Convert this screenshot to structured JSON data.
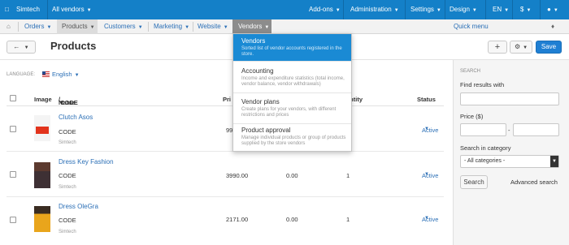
{
  "topbar": {
    "brand": "Simtech",
    "vendor_filter": "All vendors",
    "items": [
      "Add-ons",
      "Administration",
      "Settings",
      "Design"
    ],
    "lang": "EN",
    "currency": "$"
  },
  "menu": {
    "items": [
      "Orders",
      "Products",
      "Customers",
      "Marketing",
      "Website",
      "Vendors"
    ],
    "quick_menu": "Quick menu"
  },
  "header": {
    "title": "Products",
    "save_label": "Save"
  },
  "language": {
    "label": "LANGUAGE:",
    "value": "English"
  },
  "table": {
    "columns": {
      "image": "Image",
      "name": "Name",
      "code": "CODE",
      "price": "Pri",
      "quantity": "antity",
      "status": "Status"
    },
    "rows": [
      {
        "name": "Clutch Asos",
        "code": "CODE",
        "vendor": "Simtech",
        "price": "99",
        "list_price": "",
        "quantity": "",
        "status": "Active"
      },
      {
        "name": "Dress Key Fashion",
        "code": "CODE",
        "vendor": "Simtech",
        "price": "3990.00",
        "list_price": "0.00",
        "quantity": "1",
        "status": "Active"
      },
      {
        "name": "Dress OleGra",
        "code": "CODE",
        "vendor": "Simtech",
        "price": "2171.00",
        "list_price": "0.00",
        "quantity": "1",
        "status": "Active"
      }
    ]
  },
  "vendors_menu": [
    {
      "title": "Vendors",
      "desc": "Sorted list of vendor accounts registered in the store."
    },
    {
      "title": "Accounting",
      "desc": "Income and expenditure statistics (total income, vendor balance, vendor withdrawals)"
    },
    {
      "title": "Vendor plans",
      "desc": "Create plans for your vendors, with different restrictions and prices"
    },
    {
      "title": "Product approval",
      "desc": "Manage individual products or group of products supplied by the store vendors"
    }
  ],
  "search": {
    "heading": "SEARCH",
    "find_label": "Find results with",
    "price_label": "Price ($)",
    "price_dash": "-",
    "category_label": "Search in category",
    "category_value": "- All categories -",
    "search_button": "Search",
    "advanced": "Advanced search"
  },
  "colors": {
    "topbar": "#1480c8",
    "accent": "#2b6fb6",
    "save": "#1f7fd3",
    "highlight": "#1a8ad4"
  }
}
